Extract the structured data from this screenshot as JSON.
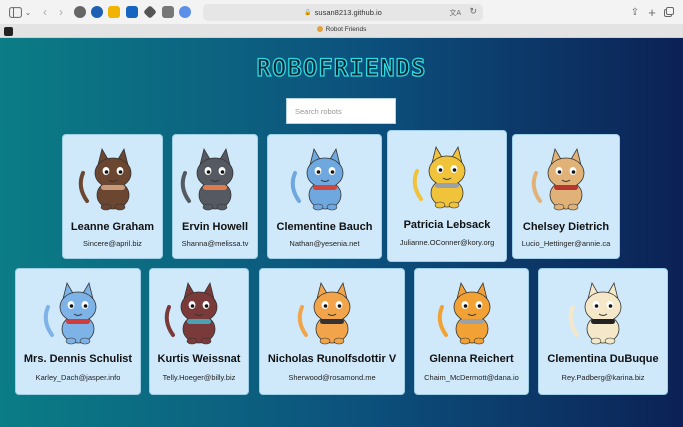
{
  "browser": {
    "url": "susan8213.github.io",
    "tab_title": "Robot Friends",
    "accent": "#2fd9e2"
  },
  "app": {
    "logo": "ROBOFRIENDS",
    "search": {
      "placeholder": "Search robots",
      "value": ""
    },
    "robots": [
      {
        "name": "Leanne Graham",
        "email": "Sincere@april.biz",
        "fur": "#6b4631",
        "accent": "#c89a7a"
      },
      {
        "name": "Ervin Howell",
        "email": "Shanna@melissa.tv",
        "fur": "#555a62",
        "accent": "#e07b4b"
      },
      {
        "name": "Clementine Bauch",
        "email": "Nathan@yesenia.net",
        "fur": "#6fa7df",
        "accent": "#d1463a"
      },
      {
        "name": "Patricia Lebsack",
        "email": "Julianne.OConner@kory.org",
        "fur": "#f0c33b",
        "accent": "#9aa1a8"
      },
      {
        "name": "Chelsey Dietrich",
        "email": "Lucio_Hettinger@annie.ca",
        "fur": "#e0b277",
        "accent": "#b7372e"
      },
      {
        "name": "Mrs. Dennis Schulist",
        "email": "Karley_Dach@jasper.info",
        "fur": "#7db3e6",
        "accent": "#cf3c3c"
      },
      {
        "name": "Kurtis Weissnat",
        "email": "Telly.Hoeger@billy.biz",
        "fur": "#7a3a3a",
        "accent": "#4aa3b5"
      },
      {
        "name": "Nicholas Runolfsdottir V",
        "email": "Sherwood@rosamond.me",
        "fur": "#f2a44a",
        "accent": "#333333"
      },
      {
        "name": "Glenna Reichert",
        "email": "Chaim_McDermott@dana.io",
        "fur": "#f2a234",
        "accent": "#9aa1a8"
      },
      {
        "name": "Clementina DuBuque",
        "email": "Rey.Padberg@karina.biz",
        "fur": "#f4e8c9",
        "accent": "#222222"
      }
    ]
  }
}
